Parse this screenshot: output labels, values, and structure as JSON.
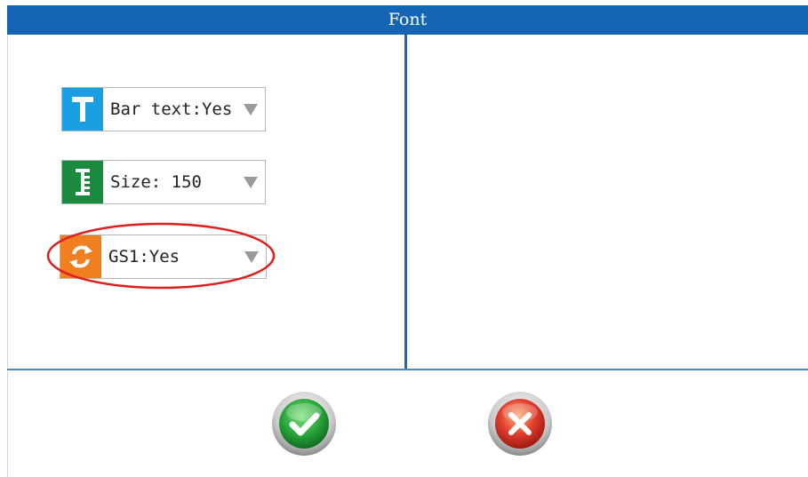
{
  "window": {
    "title": "Font"
  },
  "settings": [
    {
      "id": "bar_text",
      "label": "Bar text:Yes",
      "icon": "text-t-icon",
      "icon_color": "#1aa0e2"
    },
    {
      "id": "size",
      "label": "Size: 150",
      "icon": "size-ruler-icon",
      "icon_color": "#1a8a3e"
    },
    {
      "id": "gs1",
      "label": "GS1:Yes",
      "icon": "refresh-cycle-icon",
      "icon_color": "#f07f1f"
    }
  ],
  "highlight": {
    "target": "gs1",
    "color": "#e01e1e"
  },
  "actions": {
    "confirm": {
      "icon": "checkmark-icon",
      "color": "#27a33a"
    },
    "cancel": {
      "icon": "close-x-icon",
      "color": "#e03e2c"
    }
  }
}
